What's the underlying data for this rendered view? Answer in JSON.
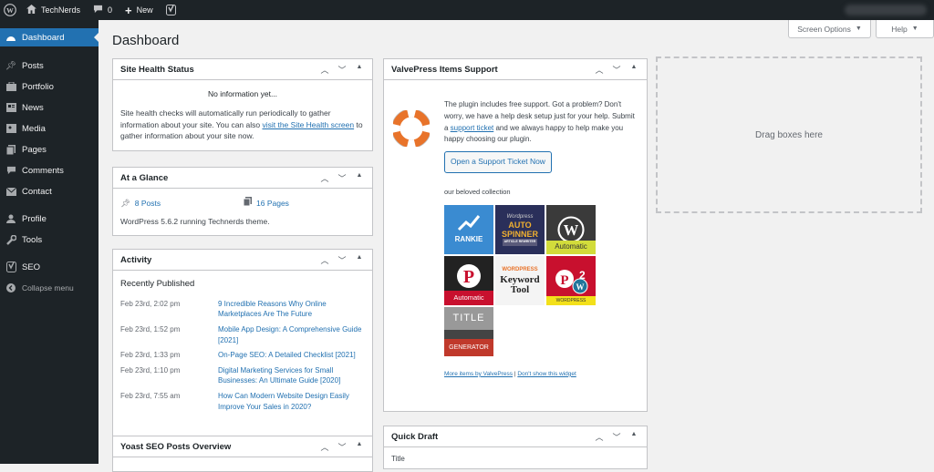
{
  "admin_bar": {
    "site_name": "TechNerds",
    "comments_count": "0",
    "new_label": "New",
    "wp_icon": "wordpress-icon",
    "home_icon": "home-icon",
    "comment_icon": "comment-bubble-icon",
    "plus_icon": "plus-icon",
    "yoast_icon": "yoast-icon"
  },
  "sidebar": {
    "items": [
      {
        "label": "Dashboard",
        "icon": "dashboard-icon"
      },
      {
        "label": "Posts",
        "icon": "pin-icon"
      },
      {
        "label": "Portfolio",
        "icon": "portfolio-icon"
      },
      {
        "label": "News",
        "icon": "news-icon"
      },
      {
        "label": "Media",
        "icon": "media-icon"
      },
      {
        "label": "Pages",
        "icon": "pages-icon"
      },
      {
        "label": "Comments",
        "icon": "comment-bubble-icon"
      },
      {
        "label": "Contact",
        "icon": "mail-icon"
      },
      {
        "label": "Profile",
        "icon": "user-icon"
      },
      {
        "label": "Tools",
        "icon": "wrench-icon"
      },
      {
        "label": "SEO",
        "icon": "yoast-icon"
      },
      {
        "label": "Collapse menu",
        "icon": "collapse-icon"
      }
    ]
  },
  "header": {
    "title": "Dashboard",
    "screen_options": "Screen Options",
    "help": "Help"
  },
  "site_health": {
    "title": "Site Health Status",
    "no_info": "No information yet...",
    "desc_pre": "Site health checks will automatically run periodically to gather information about your site. You can also ",
    "link": "visit the Site Health screen",
    "desc_post": " to gather information about your site now."
  },
  "glance": {
    "title": "At a Glance",
    "posts": "8 Posts",
    "pages": "16 Pages",
    "version": "WordPress 5.6.2 running Technerds theme."
  },
  "activity": {
    "title": "Activity",
    "section": "Recently Published",
    "items": [
      {
        "date": "Feb 23rd, 2:02 pm",
        "title": "9 Incredible Reasons Why Online Marketplaces Are The Future"
      },
      {
        "date": "Feb 23rd, 1:52 pm",
        "title": "Mobile App Design: A Comprehensive Guide [2021]"
      },
      {
        "date": "Feb 23rd, 1:33 pm",
        "title": "On-Page SEO: A Detailed Checklist [2021]"
      },
      {
        "date": "Feb 23rd, 1:10 pm",
        "title": "Digital Marketing Services for Small Businesses: An Ultimate Guide [2020]"
      },
      {
        "date": "Feb 23rd, 7:55 am",
        "title": "How Can Modern Website Design Easily Improve Your Sales in 2020?"
      }
    ]
  },
  "yoast": {
    "title": "Yoast SEO Posts Overview"
  },
  "valvepress": {
    "title": "ValvePress Items Support",
    "text_1": "The plugin includes free support. Got a problem? Don't worry, we have a help desk setup just for your help. Submit a ",
    "link": "support ticket",
    "text_2": " and we always happy to help make you happy choosing our plugin.",
    "button": "Open a Support Ticket Now",
    "collection_label": "our beloved collection",
    "tiles": [
      {
        "label": "RANKIE"
      },
      {
        "top": "Wordpress",
        "label": "AUTO SPINNER",
        "sub": "ARTICLE REWRITER"
      },
      {
        "label": "Automatic"
      },
      {
        "label": "Automatic"
      },
      {
        "top": "WORDPRESS",
        "label": "Keyword Tool"
      },
      {
        "label": "WORDPRESS"
      },
      {
        "top": "TITLE",
        "label": "GENERATOR"
      }
    ],
    "more_items": "More items by ValvePress",
    "separator": "|",
    "dont_show": "Don't show this widget"
  },
  "drop_zone": "Drag boxes here",
  "quick_draft": {
    "title": "Quick Draft",
    "title_label": "Title"
  },
  "colors": {
    "accent": "#2271b1",
    "admin_bg": "#1d2327"
  }
}
